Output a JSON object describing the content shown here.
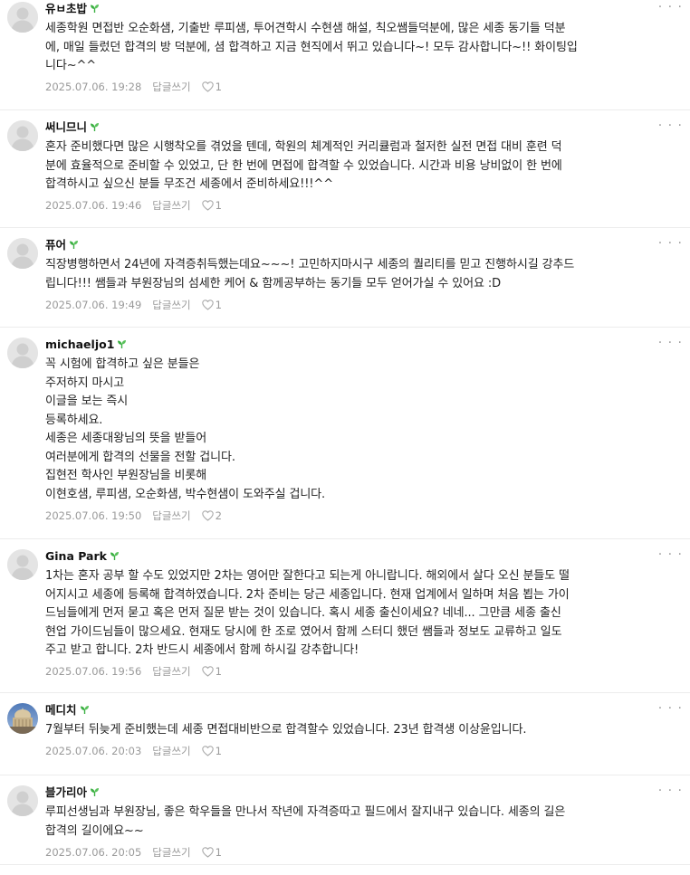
{
  "like_icon": "heart-outline-icon",
  "more_icon": "more-dots-icon",
  "leaf_icon": "sprout-icon",
  "reply_label": "답글쓰기",
  "more_label": "· · ·",
  "comments": [
    {
      "nickname": "유ㅂ초밥",
      "lines": [
        "세종학원 면접반 오순화샘, 기출반 루피샘, 투어견학시 수현샘 해설, 칙오쌤들덕분에, 많은 세종 동기들 덕분",
        "에, 매일 들렀던 합격의 방 덕분에, 셤 합격하고 지금 현직에서 뛰고 있습니다~! 모두 감사합니다~!! 화이팅입",
        "니다~^^"
      ],
      "date": "2025.07.06. 19:28",
      "likes": "1"
    },
    {
      "nickname": "써니므니",
      "lines": [
        "혼자 준비했다면 많은 시행착오를 겪었을 텐데, 학원의 체계적인 커리큘럼과 철저한 실전 면접 대비 훈련 덕",
        "분에 효율적으로 준비할 수 있었고, 단 한 번에 면접에 합격할 수 있었습니다. 시간과 비용 낭비없이 한 번에",
        "합격하시고 싶으신 분들 무조건 세종에서 준비하세요!!!^^"
      ],
      "date": "2025.07.06. 19:46",
      "likes": "1"
    },
    {
      "nickname": "퓨어",
      "lines": [
        "직장병행하면서 24년에 자격증취득했는데요~~~! 고민하지마시구 세종의 퀄리티를 믿고 진행하시길 강추드",
        "립니다!!! 쌤들과 부원장님의 섬세한 케어 & 함께공부하는 동기들 모두 얻어가실 수 있어요 :D"
      ],
      "date": "2025.07.06. 19:49",
      "likes": "1"
    },
    {
      "nickname": "michaeljo1",
      "lines": [
        "꼭 시험에 합격하고 싶은 분들은",
        "주저하지 마시고",
        "이글을 보는 즉시",
        "등록하세요.",
        "세종은 세종대왕님의 뜻을 받들어",
        "여러분에게 합격의 선물을 전할 겁니다.",
        "집현전 학사인 부원장님을 비롯해",
        "이현호샘, 루피샘, 오순화샘, 박수현샘이 도와주실 겁니다."
      ],
      "date": "2025.07.06. 19:50",
      "likes": "2"
    },
    {
      "nickname": "Gina Park",
      "lines": [
        "1차는 혼자 공부 할 수도 있었지만 2차는 영어만 잘한다고 되는게 아니랍니다. 해외에서 살다 오신 분들도 떨",
        "어지시고 세종에 등록해 합격하였습니다. 2차 준비는 당근 세종입니다. 현재 업계에서 일하며 처음 뵙는 가이",
        "드님들에게 먼저 묻고 혹은 먼저 질문 받는 것이 있습니다. 혹시 세종 출신이세요? 네네... 그만큼 세종 출신",
        "현업 가이드님들이 많으세요. 현재도 당시에 한 조로 였어서 함께 스터디 했던 쌤들과 정보도 교류하고 일도",
        "주고 받고 합니다. 2차 반드시 세종에서 함께 하시길 강추합니다!"
      ],
      "date": "2025.07.06. 19:56",
      "likes": "1"
    },
    {
      "nickname": "메디치",
      "lines": [
        "7월부터 뒤늦게 준비했는데 세종 면접대비반으로 합격할수 있었습니다. 23년 합격생 이상윤입니다."
      ],
      "date": "2025.07.06. 20:03",
      "likes": "1",
      "avatar": "photo"
    },
    {
      "nickname": "블가리아",
      "lines": [
        "루피선생님과 부원장님, 좋은 학우들을 만나서 작년에 자격증따고 필드에서 잘지내구 있습니다. 세종의 길은",
        "합격의 길이에요~~"
      ],
      "date": "2025.07.06. 20:05",
      "likes": "1"
    }
  ]
}
